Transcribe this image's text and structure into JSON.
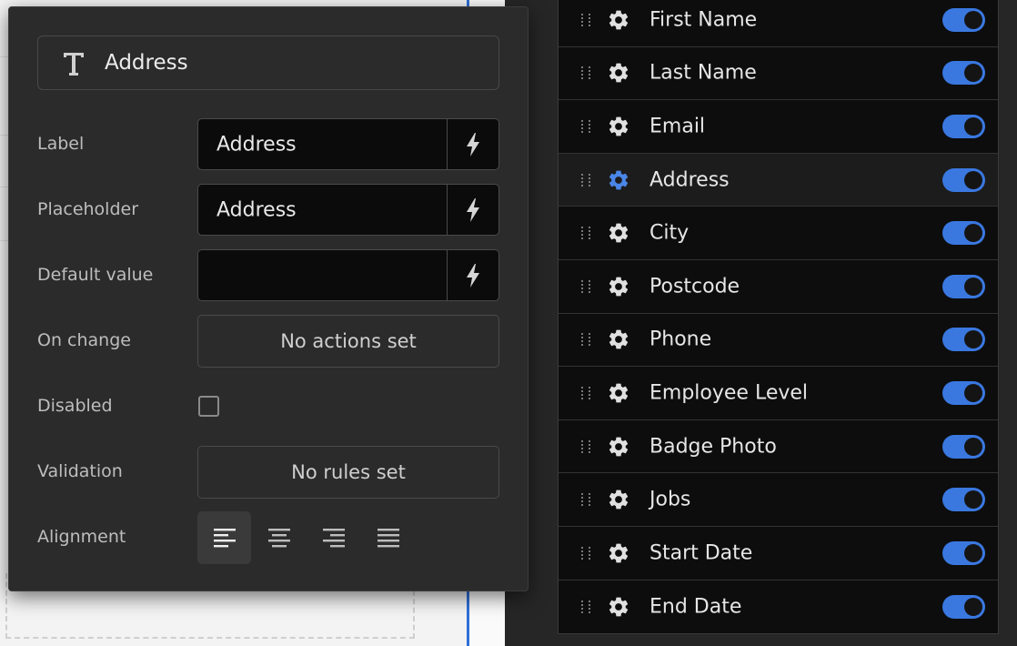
{
  "popover": {
    "header": {
      "title": "Address",
      "icon": "text-type-icon"
    },
    "properties": {
      "label": {
        "label": "Label",
        "value": "Address"
      },
      "placeholder": {
        "label": "Placeholder",
        "value": "Address"
      },
      "default_value": {
        "label": "Default value",
        "value": ""
      },
      "on_change": {
        "label": "On change",
        "action_text": "No actions set"
      },
      "disabled": {
        "label": "Disabled",
        "checked": false
      },
      "validation": {
        "label": "Validation",
        "rules_text": "No rules set"
      },
      "alignment": {
        "label": "Alignment",
        "options": [
          "left",
          "center",
          "right",
          "justify"
        ],
        "selected": "left"
      }
    }
  },
  "fields": [
    {
      "label": "First Name",
      "enabled": true
    },
    {
      "label": "Last Name",
      "enabled": true
    },
    {
      "label": "Email",
      "enabled": true
    },
    {
      "label": "Address",
      "enabled": true,
      "active": true
    },
    {
      "label": "City",
      "enabled": true
    },
    {
      "label": "Postcode",
      "enabled": true
    },
    {
      "label": "Phone",
      "enabled": true
    },
    {
      "label": "Employee Level",
      "enabled": true
    },
    {
      "label": "Badge Photo",
      "enabled": true
    },
    {
      "label": "Jobs",
      "enabled": true
    },
    {
      "label": "Start Date",
      "enabled": true
    },
    {
      "label": "End Date",
      "enabled": true
    }
  ],
  "colors": {
    "accent": "#3a78e0",
    "panel_bg": "#2b2b2b",
    "list_bg": "#0d0d0d",
    "active_gear": "#4a86e8"
  }
}
